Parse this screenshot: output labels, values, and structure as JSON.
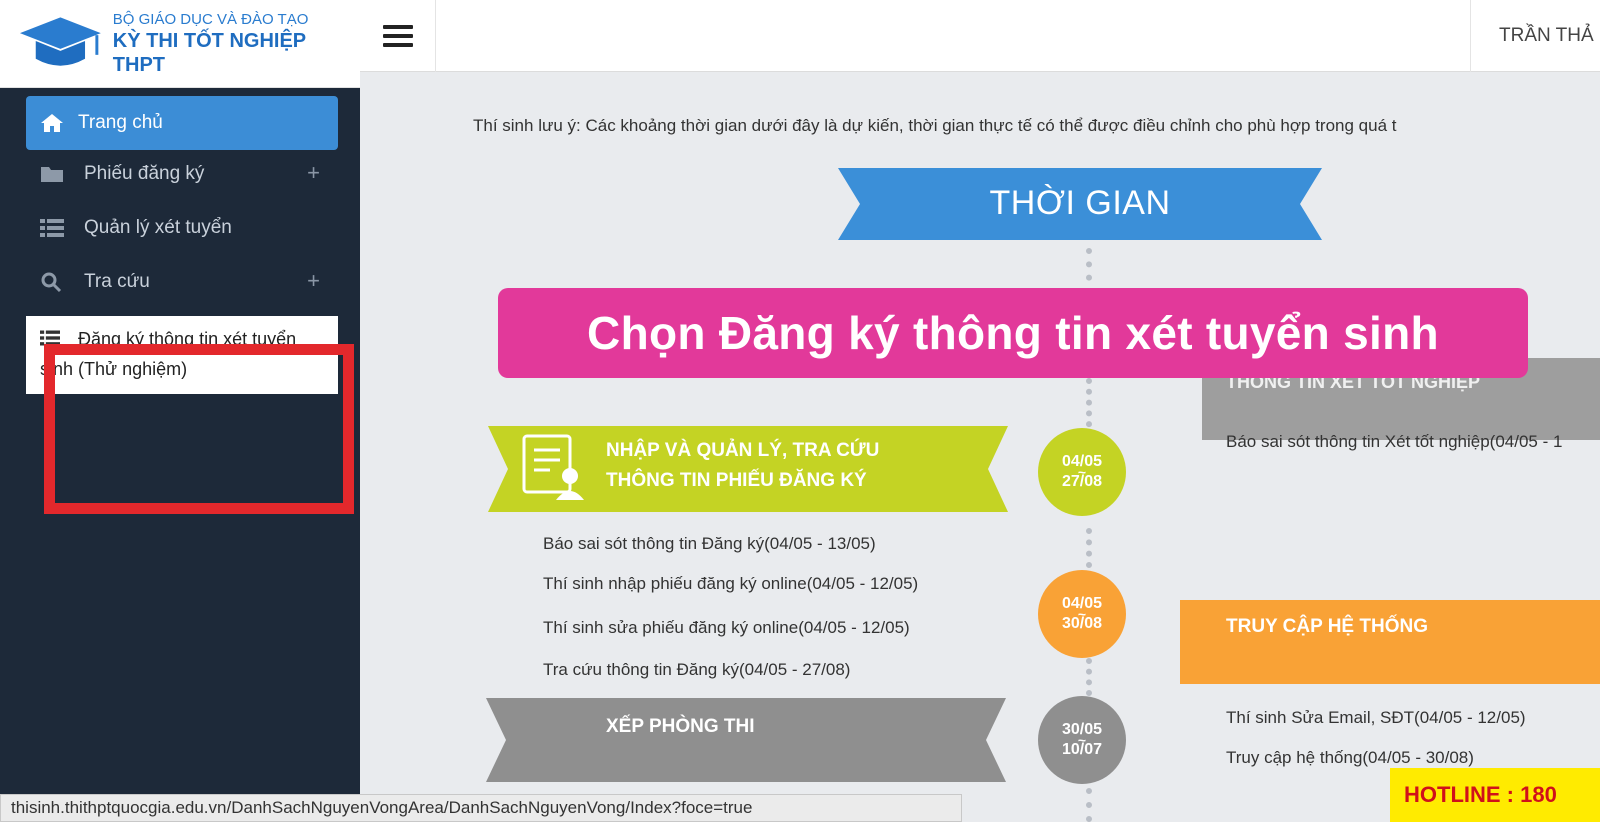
{
  "logo": {
    "line1": "BỘ GIÁO DỤC VÀ ĐÀO TẠO",
    "line2": "KỲ THI TỐT NGHIỆP THPT"
  },
  "header": {
    "user_name": "TRẦN THẢ"
  },
  "sidebar": {
    "items": [
      {
        "label": "Trang chủ",
        "icon": "home-icon",
        "active": true
      },
      {
        "label": "Phiếu đăng ký",
        "icon": "folder-icon",
        "expandable": true
      },
      {
        "label": "Quản lý xét tuyển",
        "icon": "list-icon"
      },
      {
        "label": "Tra cứu",
        "icon": "search-icon",
        "expandable": true
      },
      {
        "label": "Đăng ký thông tin xét tuyển sinh (Thử nghiệm)",
        "icon": "list-icon"
      }
    ],
    "highlight_color": "#e3282c"
  },
  "main": {
    "notice": "Thí sinh lưu ý: Các khoảng thời gian dưới đây là dự kiến, thời gian thực tế có thể được điều chỉnh cho phù hợp trong quá t",
    "timeline_title": "THỜI GIAN",
    "overlay_caption": "Chọn Đăng ký thông tin xét tuyển sinh",
    "sections": {
      "xet_tot_nghiep": {
        "header": "THÔNG TIN XÉT TỐT NGHIỆP",
        "items": [
          "Báo sai sót thông tin Xét tốt nghiệp(04/05 - 1"
        ]
      },
      "nhap_quan_ly": {
        "header_line1": "NHẬP VÀ QUẢN LÝ, TRA CỨU",
        "header_line2": "THÔNG TIN PHIẾU ĐĂNG KÝ",
        "items": [
          "Báo sai sót thông tin Đăng ký(04/05 - 13/05)",
          "Thí sinh nhập phiếu đăng ký online(04/05 - 12/05)",
          "Thí sinh sửa phiếu đăng ký online(04/05 - 12/05)",
          "Tra cứu thông tin Đăng ký(04/05 - 27/08)"
        ]
      },
      "truy_cap": {
        "header": "TRUY CẬP HỆ THỐNG",
        "items": [
          "Thí sinh Sửa Email, SĐT(04/05 - 12/05)",
          "Truy cập hệ thống(04/05 - 30/08)"
        ]
      },
      "xep_phong": {
        "header": "XẾP PHÒNG THI"
      }
    },
    "dates": [
      {
        "start": "04/05",
        "end": "27/08",
        "color": "#c4d324"
      },
      {
        "start": "04/05",
        "end": "30/08",
        "color": "#f9a236"
      },
      {
        "start": "30/05",
        "end": "10/07",
        "color": "#8f8f8f"
      }
    ]
  },
  "status_url": "thisinh.thithptquocgia.edu.vn/DanhSachNguyenVongArea/DanhSachNguyenVong/Index?foce=true",
  "hotline": "HOTLINE : 180"
}
